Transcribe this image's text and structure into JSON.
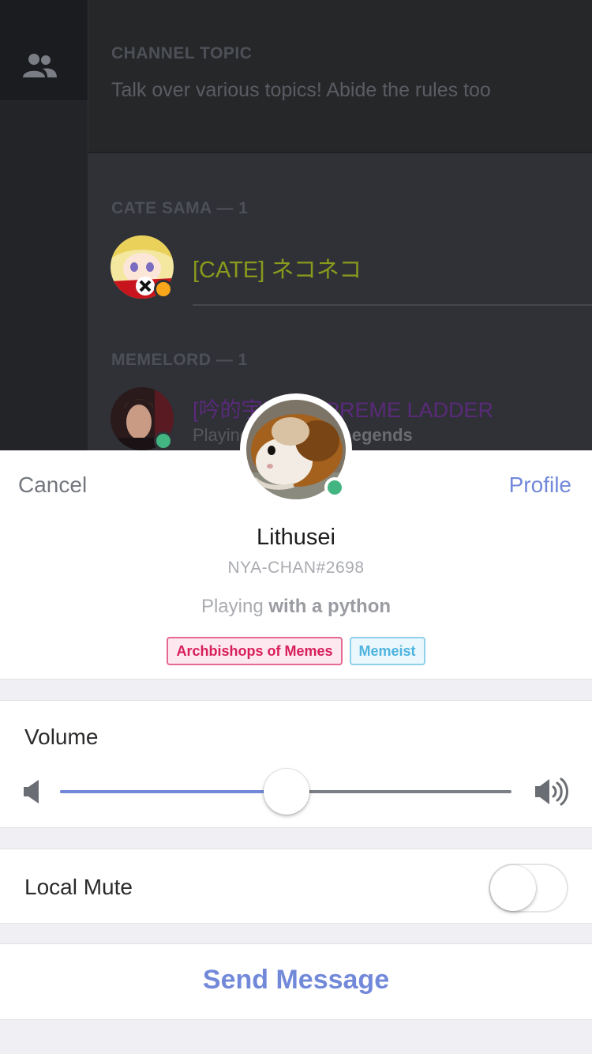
{
  "background": {
    "channel_topic_heading": "CHANNEL TOPIC",
    "channel_topic": "Talk over various topics! Abide the rules too",
    "groups": [
      {
        "heading": "CATE SAMA — 1",
        "member_name": "[CATE] ネコネコ",
        "status_color": "#faa61a"
      },
      {
        "heading": "MEMELORD — 1",
        "member_name": "[吟的宇宙] SUPREME LADDER",
        "activity_prefix": "Playing ",
        "activity_game": "League of Legends",
        "status_color": "#43b581"
      }
    ]
  },
  "sheet": {
    "cancel_label": "Cancel",
    "profile_label": "Profile",
    "username": "Lithusei",
    "discriminator": "NYA-CHAN#2698",
    "activity_prefix": "Playing ",
    "activity_game": "with a python",
    "status_color": "#43b581",
    "roles": [
      {
        "name": "Archbishops of Memes",
        "color": "#d81e5b"
      },
      {
        "name": "Memeist",
        "color": "#4fb4de"
      }
    ]
  },
  "volume": {
    "label": "Volume",
    "level": 0.502
  },
  "local_mute": {
    "label": "Local Mute",
    "enabled": false
  },
  "send_message": {
    "label": "Send Message"
  },
  "colors": {
    "accent": "#7289da",
    "online": "#43b581",
    "idle": "#faa61a"
  }
}
